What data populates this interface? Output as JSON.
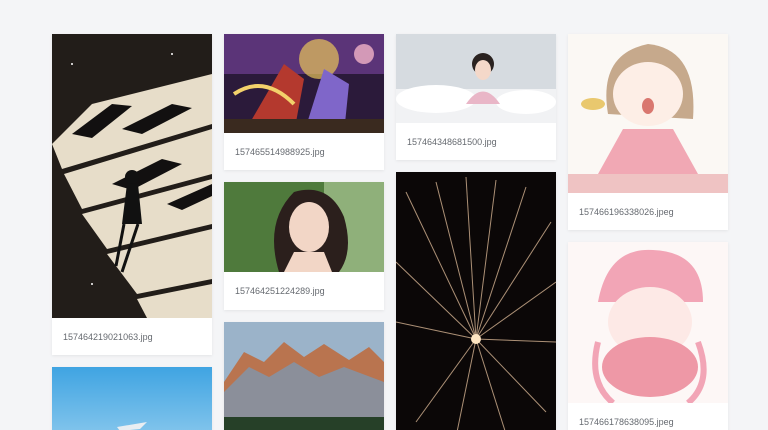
{
  "gallery": {
    "items": [
      {
        "filename": "157464219021063.jpg",
        "subject": "piano-girl-illustration"
      },
      {
        "filename": "",
        "subject": "seaside-sky-photo"
      },
      {
        "filename": "157465514988925.jpg",
        "subject": "anime-warriors-artwork"
      },
      {
        "filename": "157464251224289.jpg",
        "subject": "portrait-photo"
      },
      {
        "filename": "",
        "subject": "mountain-landscape-photo"
      },
      {
        "filename": "157464348681500.jpg",
        "subject": "girl-in-bed-photo"
      },
      {
        "filename": "",
        "subject": "fireworks-photo"
      },
      {
        "filename": "157466196338026.jpeg",
        "subject": "crying-girl-sketch"
      },
      {
        "filename": "157466178638095.jpeg",
        "subject": "pink-hat-girl-sketch"
      }
    ]
  },
  "colors": {
    "page_background": "#f4f5f7",
    "card_background": "#ffffff",
    "caption_text": "#666a70"
  }
}
